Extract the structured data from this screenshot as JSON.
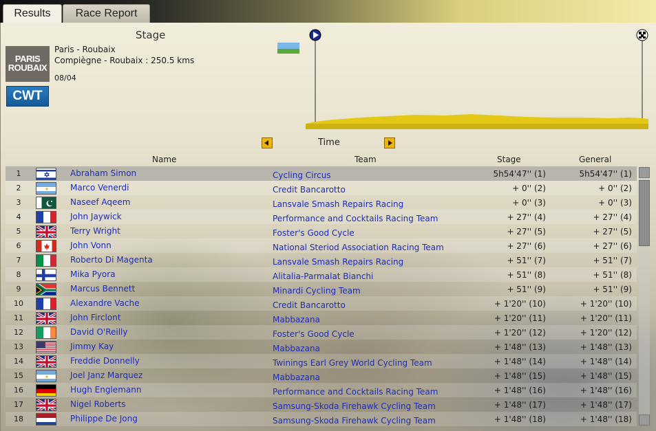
{
  "tabs": [
    {
      "label": "Results",
      "active": true
    },
    {
      "label": "Race Report",
      "active": false
    }
  ],
  "race": {
    "section_title": "Stage",
    "logo_text_1": "PARIS",
    "logo_text_2": "ROUBAIX",
    "category_badge": "CWT",
    "name": "Paris - Roubaix",
    "route": "Compiègne - Roubaix : 250.5 kms",
    "date": "08/04",
    "terrain_icon": "flat-terrain-icon"
  },
  "selector": {
    "label": "Time"
  },
  "columns": {
    "name": "Name",
    "team": "Team",
    "stage": "Stage",
    "general": "General"
  },
  "colors": {
    "link": "#1d2db8",
    "accent": "#f0b410",
    "badge": "#145a99",
    "profile_fill": "#e3c816"
  },
  "rows": [
    {
      "rank": "1",
      "flag": "israel",
      "name": "Abraham Simon",
      "team": "Cycling Circus",
      "stage": "5h54'47'' (1)",
      "general": "5h54'47'' (1)"
    },
    {
      "rank": "2",
      "flag": "argentina",
      "name": "Marco Venerdi",
      "team": "Credit Bancarotto",
      "stage": "+ 0'' (2)",
      "general": "+ 0'' (2)"
    },
    {
      "rank": "3",
      "flag": "pakistan",
      "name": "Naseef Aqeem",
      "team": "Lansvale Smash Repairs Racing",
      "stage": "+ 0'' (3)",
      "general": "+ 0'' (3)"
    },
    {
      "rank": "4",
      "flag": "france",
      "name": "John Jaywick",
      "team": "Performance and Cocktails Racing Team",
      "stage": "+ 27'' (4)",
      "general": "+ 27'' (4)"
    },
    {
      "rank": "5",
      "flag": "uk",
      "name": "Terry Wright",
      "team": "Foster's Good Cycle",
      "stage": "+ 27'' (5)",
      "general": "+ 27'' (5)"
    },
    {
      "rank": "6",
      "flag": "canada",
      "name": "John Vonn",
      "team": "National Steriod Association Racing Team",
      "stage": "+ 27'' (6)",
      "general": "+ 27'' (6)"
    },
    {
      "rank": "7",
      "flag": "italy",
      "name": "Roberto Di Magenta",
      "team": "Lansvale Smash Repairs Racing",
      "stage": "+ 51'' (7)",
      "general": "+ 51'' (7)"
    },
    {
      "rank": "8",
      "flag": "finland",
      "name": "Mika Pyora",
      "team": "Alitalia-Parmalat Bianchi",
      "stage": "+ 51'' (8)",
      "general": "+ 51'' (8)"
    },
    {
      "rank": "9",
      "flag": "south-africa",
      "name": "Marcus Bennett",
      "team": "Minardi Cycling Team",
      "stage": "+ 51'' (9)",
      "general": "+ 51'' (9)"
    },
    {
      "rank": "10",
      "flag": "france",
      "name": "Alexandre Vache",
      "team": "Credit Bancarotto",
      "stage": "+ 1'20'' (10)",
      "general": "+ 1'20'' (10)"
    },
    {
      "rank": "11",
      "flag": "uk",
      "name": "John Firclont",
      "team": "Mabbazana",
      "stage": "+ 1'20'' (11)",
      "general": "+ 1'20'' (11)"
    },
    {
      "rank": "12",
      "flag": "ireland",
      "name": "David O'Reilly",
      "team": "Foster's Good Cycle",
      "stage": "+ 1'20'' (12)",
      "general": "+ 1'20'' (12)"
    },
    {
      "rank": "13",
      "flag": "usa",
      "name": "Jimmy Kay",
      "team": "Mabbazana",
      "stage": "+ 1'48'' (13)",
      "general": "+ 1'48'' (13)"
    },
    {
      "rank": "14",
      "flag": "uk",
      "name": "Freddie Donnelly",
      "team": "Twinings Earl Grey World Cycling Team",
      "stage": "+ 1'48'' (14)",
      "general": "+ 1'48'' (14)"
    },
    {
      "rank": "15",
      "flag": "argentina",
      "name": "Joel Janz Marquez",
      "team": "Mabbazana",
      "stage": "+ 1'48'' (15)",
      "general": "+ 1'48'' (15)"
    },
    {
      "rank": "16",
      "flag": "germany",
      "name": "Hugh Englemann",
      "team": "Performance and Cocktails Racing Team",
      "stage": "+ 1'48'' (16)",
      "general": "+ 1'48'' (16)"
    },
    {
      "rank": "17",
      "flag": "uk",
      "name": "Nigel Roberts",
      "team": "Samsung-Skoda Firehawk Cycling Team",
      "stage": "+ 1'48'' (17)",
      "general": "+ 1'48'' (17)"
    },
    {
      "rank": "18",
      "flag": "netherlands",
      "name": "Philippe De Jong",
      "team": "Samsung-Skoda Firehawk Cycling Team",
      "stage": "+ 1'48'' (18)",
      "general": "+ 1'48'' (18)"
    }
  ]
}
